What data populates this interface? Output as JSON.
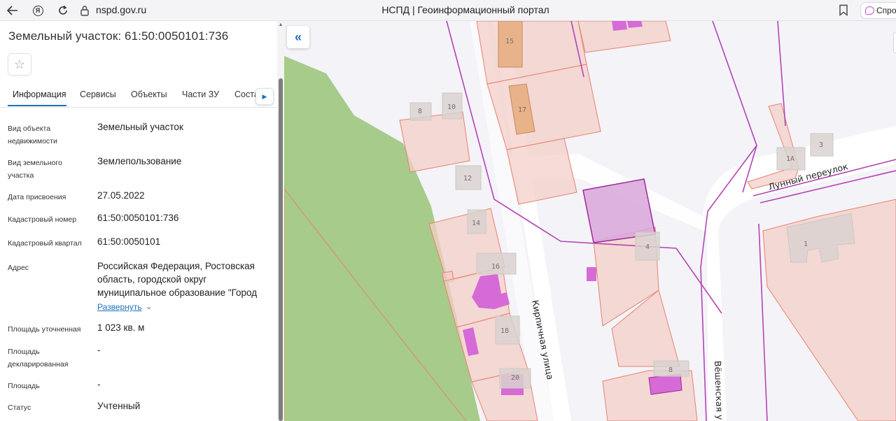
{
  "browser": {
    "url": "nspd.gov.ru",
    "title": "НСПД | Геоинформационный портал",
    "ask_label": "Спросить",
    "yandex_glyph": "Я"
  },
  "panel": {
    "title": "Земельный участок: 61:50:0050101:736",
    "tabs": [
      "Информация",
      "Сервисы",
      "Объекты",
      "Части ЗУ",
      "Состав"
    ],
    "fields": [
      {
        "label": "Вид объекта недвижимости",
        "value": "Земельный участок"
      },
      {
        "label": "Вид земельного участка",
        "value": "Землепользование"
      },
      {
        "label": "Дата присвоения",
        "value": "27.05.2022"
      },
      {
        "label": "Кадастровый номер",
        "value": "61:50:0050101:736"
      },
      {
        "label": "Кадастровый квартал",
        "value": "61:50:0050101"
      },
      {
        "label": "Адрес",
        "value": "Российская Федерация, Ростовская область, городской округ муниципальное образование \"Город"
      },
      {
        "label": "Площадь уточненная",
        "value": "1 023 кв. м"
      },
      {
        "label": "Площадь декларированная",
        "value": "-"
      },
      {
        "label": "Площадь",
        "value": "-"
      },
      {
        "label": "Статус",
        "value": "Учтенный"
      }
    ],
    "expand_label": "Развернуть"
  },
  "map": {
    "streets": {
      "kirpichnaya": "Кирпичная улица",
      "lunny": "Лунный переулок",
      "veshenskaya": "Вёшенская у"
    },
    "house_numbers": [
      "15",
      "17",
      "8",
      "10",
      "12",
      "14",
      "16",
      "18",
      "20",
      "4",
      "8",
      "1А",
      "3",
      "1"
    ],
    "colors": {
      "parcel_fill": "#f3cfc8",
      "parcel_stroke": "#e8826e",
      "selected_fill": "#d9a6da",
      "selected_stroke": "#a0289a",
      "green_zone": "#9dc77e",
      "building_magenta": "#d66ad6",
      "building_orange": "#e8b38a",
      "building_grey": "#d9d2d0"
    }
  },
  "icons": {
    "back": "arrow-left-icon",
    "reload": "reload-icon",
    "lock": "lock-icon",
    "bookmark": "bookmark-icon",
    "favorite": "star-icon",
    "collapse": "double-chevron-left-icon",
    "tabs_next": "triangle-right-icon",
    "expand": "chevron-down-icon"
  }
}
